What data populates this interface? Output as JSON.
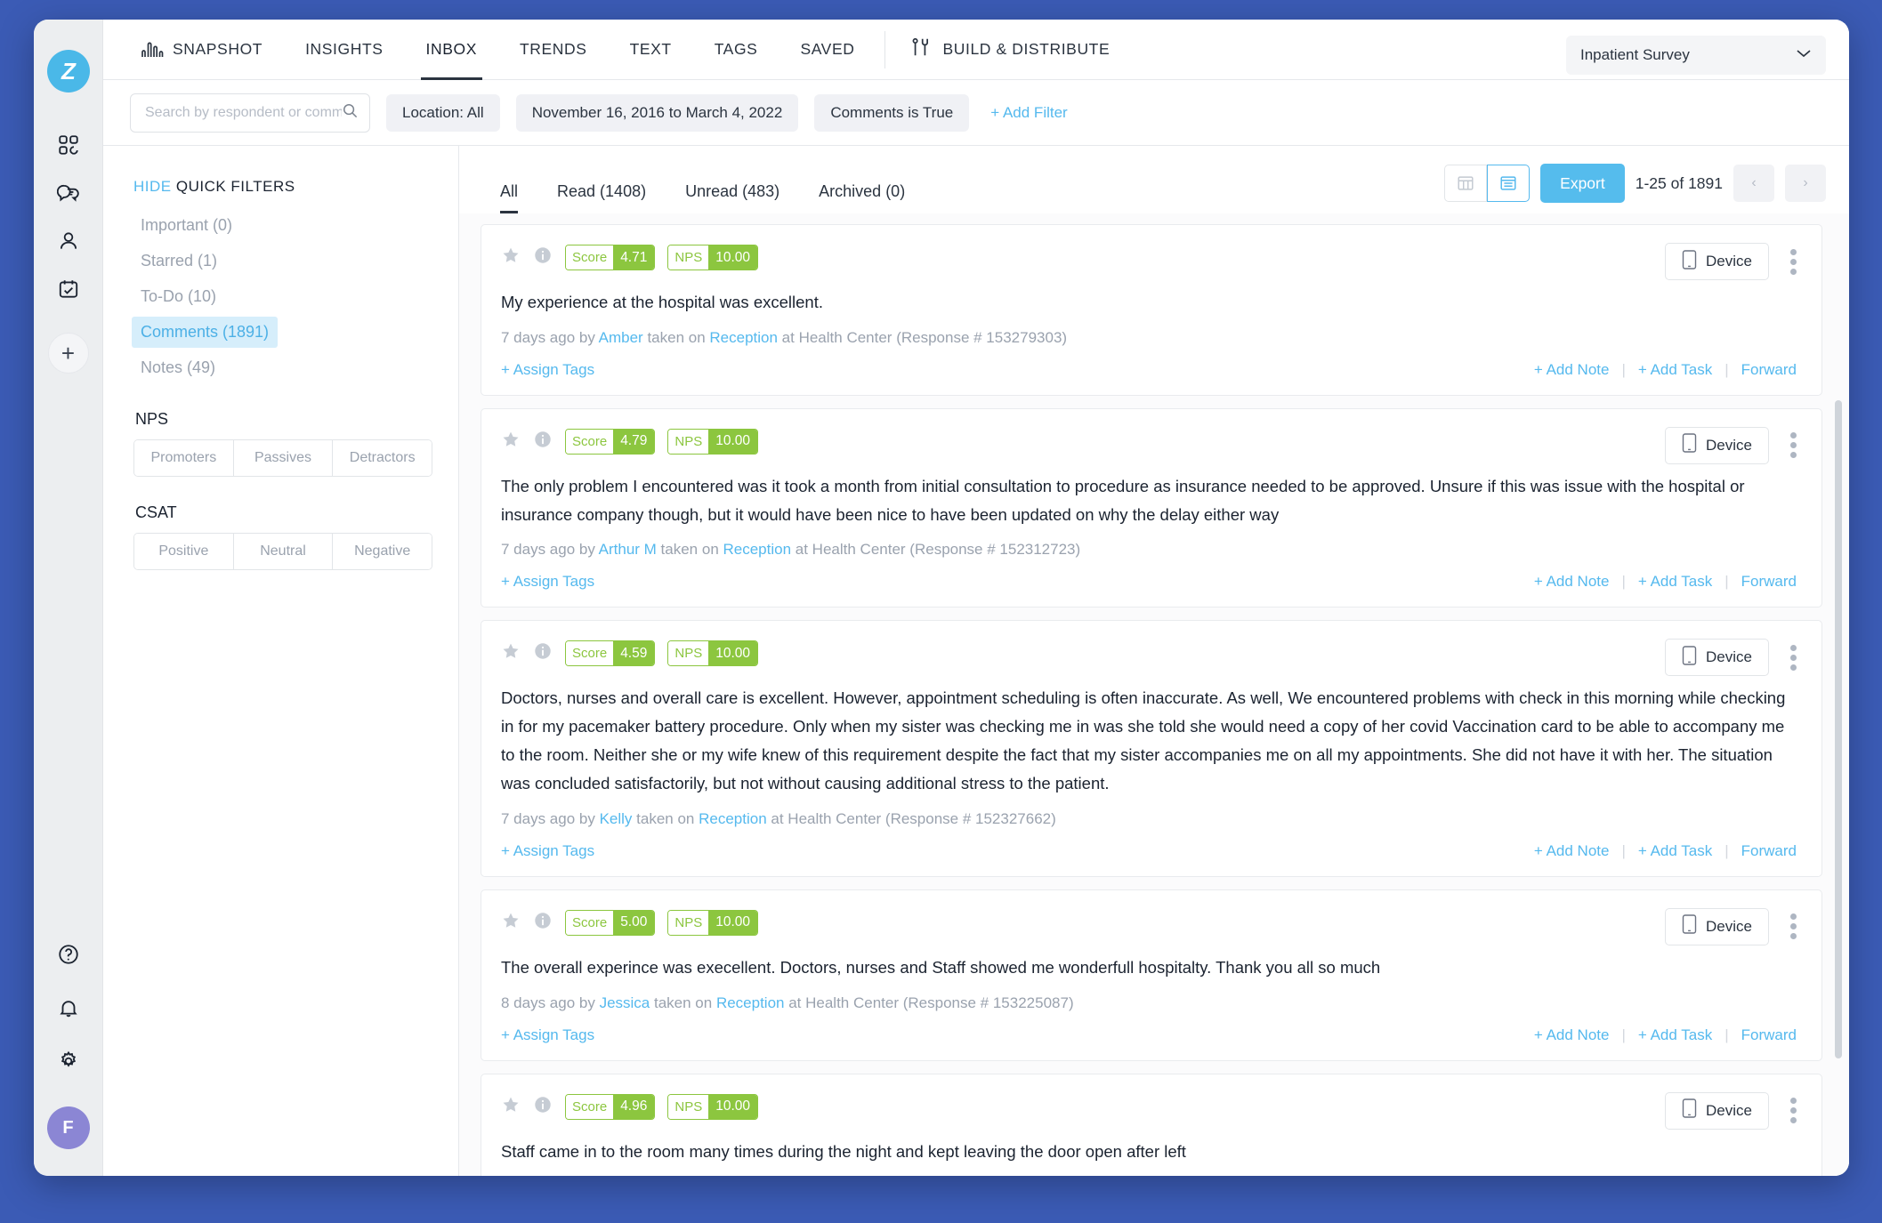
{
  "brand": {
    "logo_letter": "Z",
    "accent": "#55b9ee",
    "green": "#8cc63f"
  },
  "topnav": {
    "items": [
      {
        "label": "SNAPSHOT",
        "active": false,
        "icon": "bar-chart-icon"
      },
      {
        "label": "INSIGHTS",
        "active": false
      },
      {
        "label": "INBOX",
        "active": true
      },
      {
        "label": "TRENDS",
        "active": false
      },
      {
        "label": "TEXT",
        "active": false
      },
      {
        "label": "TAGS",
        "active": false
      },
      {
        "label": "SAVED",
        "active": false
      }
    ],
    "build_distribute": "BUILD & DISTRIBUTE",
    "survey_selected": "Inpatient Survey"
  },
  "filterbar": {
    "search_placeholder": "Search by respondent or comments",
    "search_value": "",
    "chips": [
      "Location: All",
      "November 16, 2016 to March 4, 2022",
      "Comments is True"
    ],
    "add_filter": "+ Add Filter"
  },
  "quickfilters": {
    "hide_label": "HIDE",
    "title": "QUICK FILTERS",
    "items": [
      {
        "label": "Important (0)",
        "selected": false
      },
      {
        "label": "Starred (1)",
        "selected": false
      },
      {
        "label": "To-Do (10)",
        "selected": false
      },
      {
        "label": "Comments (1891)",
        "selected": true
      },
      {
        "label": "Notes (49)",
        "selected": false
      }
    ],
    "nps_title": "NPS",
    "nps_options": [
      "Promoters",
      "Passives",
      "Detractors"
    ],
    "csat_title": "CSAT",
    "csat_options": [
      "Positive",
      "Neutral",
      "Negative"
    ]
  },
  "inbox": {
    "tabs": [
      {
        "label": "All",
        "active": true
      },
      {
        "label": "Read (1408)",
        "active": false
      },
      {
        "label": "Unread (483)",
        "active": false
      },
      {
        "label": "Archived (0)",
        "active": false
      }
    ],
    "export_label": "Export",
    "page_count": "1-25 of 1891",
    "prev_label": "‹",
    "next_label": "›"
  },
  "card_labels": {
    "score_label": "Score",
    "nps_label": "NPS",
    "device_label": "Device",
    "assign_tags": "+ Assign Tags",
    "add_note": "+ Add Note",
    "add_task": "+ Add Task",
    "forward": "Forward",
    "separator": "|"
  },
  "cards": [
    {
      "score": "4.71",
      "nps": "10.00",
      "comment": "My experience at the hospital was excellent.",
      "meta_time": "7 days ago by ",
      "meta_user": "Amber",
      "meta_mid": " taken on ",
      "meta_channel": "Reception",
      "meta_tail": " at Health Center (Response # 153279303)"
    },
    {
      "score": "4.79",
      "nps": "10.00",
      "comment": "The only problem I encountered was it took a month from initial consultation to procedure as insurance needed to be approved. Unsure if this was issue with the hospital or insurance company though, but it would have been nice to have been updated on why the delay either way",
      "meta_time": "7 days ago by ",
      "meta_user": "Arthur M",
      "meta_mid": " taken on ",
      "meta_channel": "Reception",
      "meta_tail": " at Health Center (Response # 152312723)"
    },
    {
      "score": "4.59",
      "nps": "10.00",
      "comment": "Doctors, nurses and overall care is excellent. However, appointment scheduling is often inaccurate. As well, We encountered problems with check in this morning while checking in for my pacemaker battery procedure. Only when my sister was checking me in was she told she would need a copy of her covid Vaccination card to be able to accompany me to the room. Neither she or my wife knew of this requirement despite the fact that my sister accompanies me on all my appointments. She did not have it with her. The situation was concluded satisfactorily, but not without causing additional stress to the patient.",
      "meta_time": "7 days ago by ",
      "meta_user": "Kelly",
      "meta_mid": " taken on ",
      "meta_channel": "Reception",
      "meta_tail": " at Health Center (Response # 152327662)"
    },
    {
      "score": "5.00",
      "nps": "10.00",
      "comment": "The overall experince was execellent. Doctors, nurses and Staff showed me wonderfull hospitalty. Thank you all so much",
      "meta_time": "8 days ago by ",
      "meta_user": "Jessica",
      "meta_mid": " taken on ",
      "meta_channel": "Reception",
      "meta_tail": " at Health Center (Response # 153225087)"
    },
    {
      "score": "4.96",
      "nps": "10.00",
      "comment": "Staff came in to the room many times during the night and kept leaving the door open after left",
      "meta_time": "",
      "meta_user": "",
      "meta_mid": "",
      "meta_channel": "",
      "meta_tail": ""
    }
  ]
}
